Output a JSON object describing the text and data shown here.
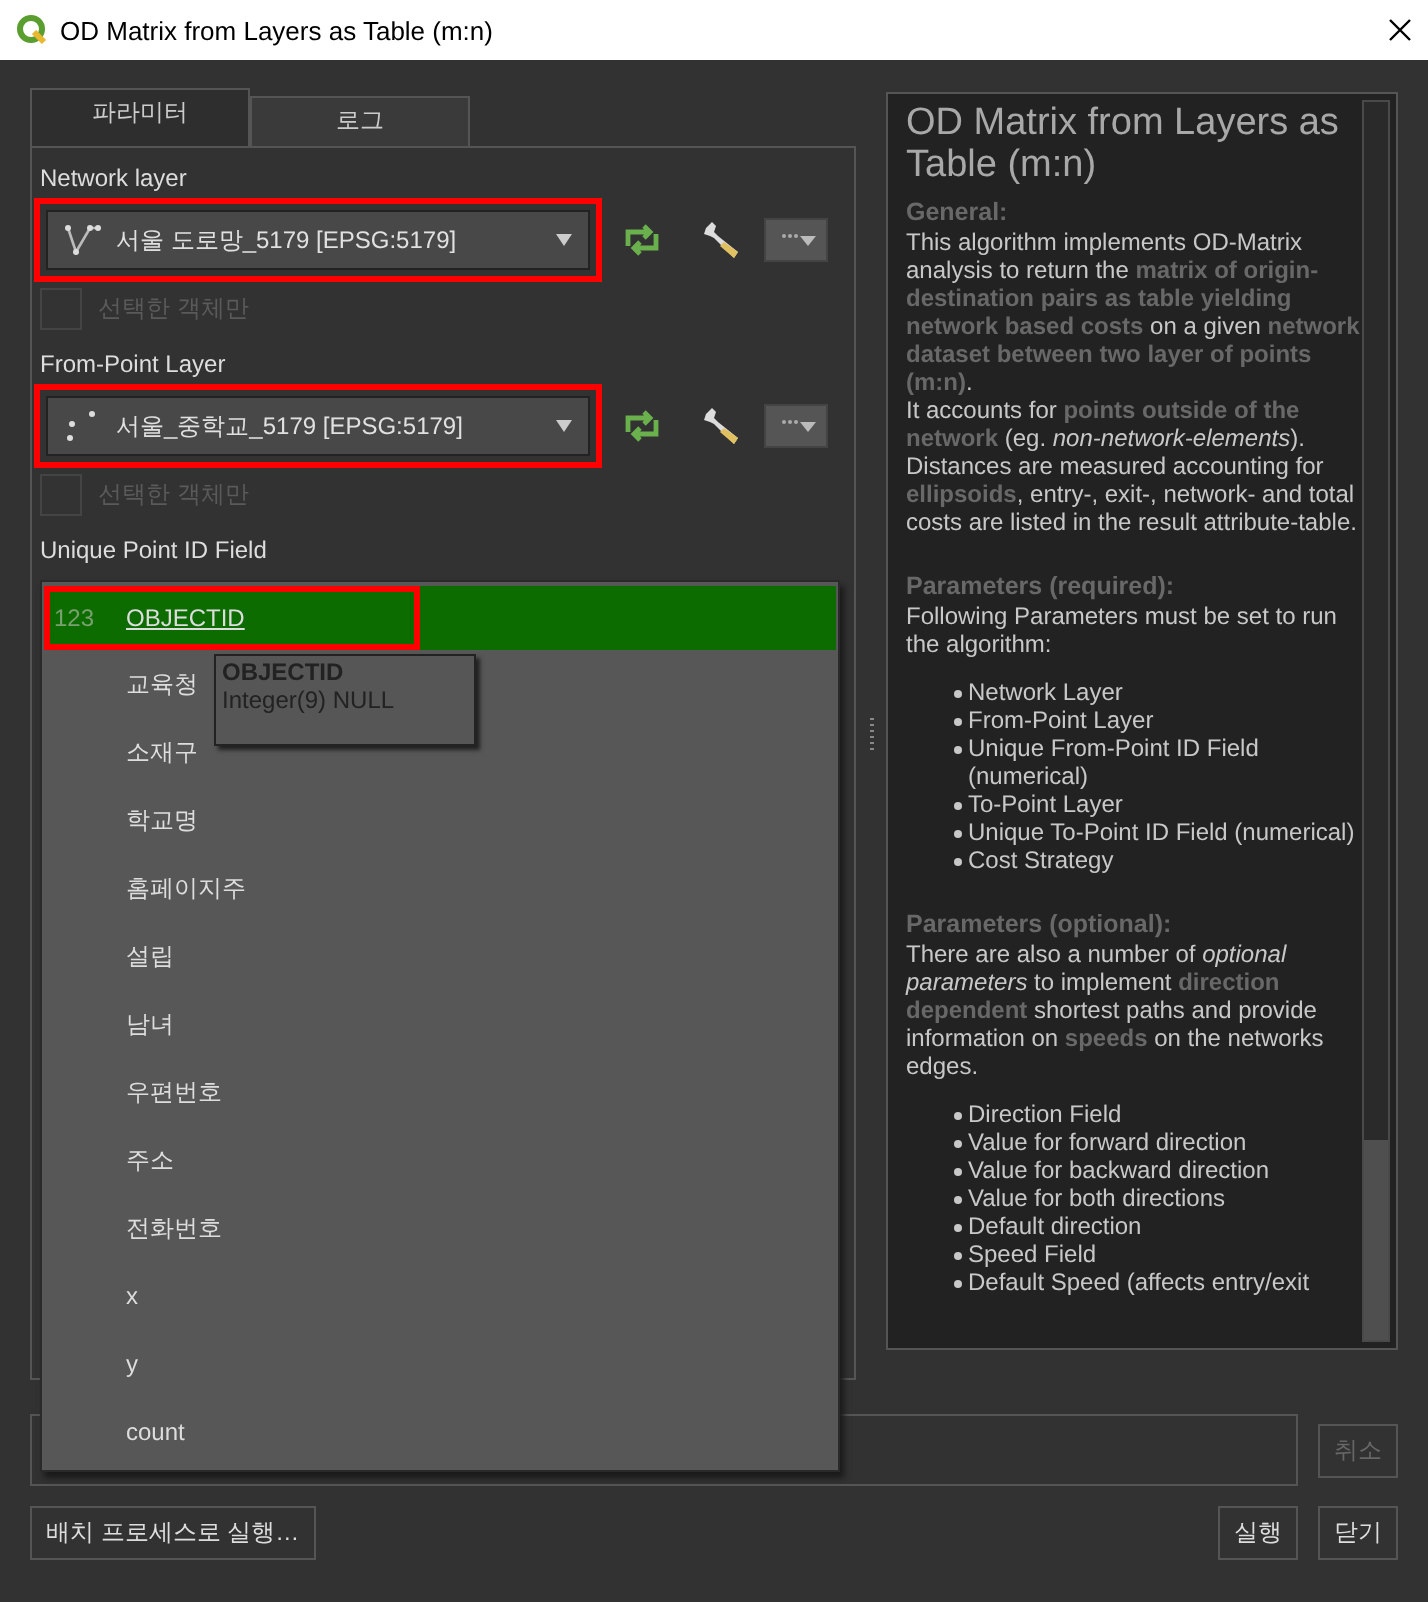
{
  "window": {
    "title": "OD Matrix from Layers as Table (m:n)"
  },
  "tabs": [
    {
      "label": "파라미터",
      "selected": true
    },
    {
      "label": "로그",
      "selected": false
    }
  ],
  "parameters": [
    {
      "kind": "line-layer",
      "label": "Network layer",
      "value": "서울 도로망_5179 [EPSG:5179]",
      "highlighted": true,
      "selected_only": {
        "label": "선택한 객체만",
        "checked": false,
        "disabled": true
      }
    },
    {
      "kind": "point-layer",
      "label": "From-Point Layer",
      "value": "서울_중학교_5179 [EPSG:5179]",
      "highlighted": true,
      "selected_only": {
        "label": "선택한 객체만",
        "checked": false,
        "disabled": true
      }
    },
    {
      "kind": "field",
      "label": "Unique Point ID Field"
    }
  ],
  "field_dropdown": {
    "items": [
      {
        "type": "123",
        "name": "OBJECTID",
        "selected": true,
        "highlighted": true
      },
      {
        "name": "교육청",
        "selected": false,
        "highlighted": false
      },
      {
        "name": "소재구",
        "selected": false,
        "highlighted": false
      },
      {
        "name": "학교명",
        "selected": false,
        "highlighted": false
      },
      {
        "name": "홈페이지주",
        "selected": false,
        "highlighted": false
      },
      {
        "name": "설립",
        "selected": false,
        "highlighted": false
      },
      {
        "name": "남녀",
        "selected": false,
        "highlighted": false
      },
      {
        "name": "우편번호",
        "selected": false,
        "highlighted": false
      },
      {
        "name": "주소",
        "selected": false,
        "highlighted": false
      },
      {
        "name": "전화번호",
        "selected": false,
        "highlighted": false
      },
      {
        "name": "x",
        "selected": false,
        "highlighted": false
      },
      {
        "name": "y",
        "selected": false,
        "highlighted": false
      },
      {
        "name": "count",
        "selected": false,
        "highlighted": false
      }
    ],
    "tooltip": {
      "title": "OBJECTID",
      "detail": "Integer(9) NULL"
    }
  },
  "help": {
    "title": "OD Matrix from Layers as Table (m:n)",
    "blocks": [
      {
        "kind": "heading",
        "text": "General:"
      },
      {
        "kind": "paragraph",
        "text": "This algorithm implements OD-Matrix analysis to return the **matrix of origin-destination pairs as table yielding network based costs** on a given **network dataset between two layer of points (m:n)**."
      },
      {
        "kind": "paragraph",
        "text": "It accounts for **points outside of the network** (eg. *non-network-elements*). Distances are measured accounting for **ellipsoids**, entry-, exit-, network- and total costs are listed in the result attribute-table."
      },
      {
        "kind": "heading",
        "text": "Parameters (required):"
      },
      {
        "kind": "paragraph",
        "text": "Following Parameters must be set to run the algorithm:"
      },
      {
        "kind": "list",
        "items": [
          "Network Layer",
          "From-Point Layer",
          "Unique From-Point ID Field (numerical)",
          "To-Point Layer",
          "Unique To-Point ID Field (numerical)",
          "Cost Strategy"
        ]
      },
      {
        "kind": "heading",
        "text": "Parameters (optional):"
      },
      {
        "kind": "paragraph",
        "text": "There are also a number of *optional parameters* to implement **direction dependent** shortest paths and provide information on **speeds** on the networks edges."
      },
      {
        "kind": "list",
        "items": [
          "Direction Field",
          "Value for forward direction",
          "Value for backward direction",
          "Value for both directions",
          "Default direction",
          "Speed Field",
          "Default Speed (affects entry/exit"
        ]
      }
    ]
  },
  "cancel_button": {
    "label": "취소",
    "disabled": true
  },
  "buttons": [
    {
      "label": "배치 프로세스로 실행…",
      "kind": "left"
    },
    {
      "label": "실행",
      "kind": "right"
    },
    {
      "label": "닫기",
      "kind": "right"
    }
  ]
}
